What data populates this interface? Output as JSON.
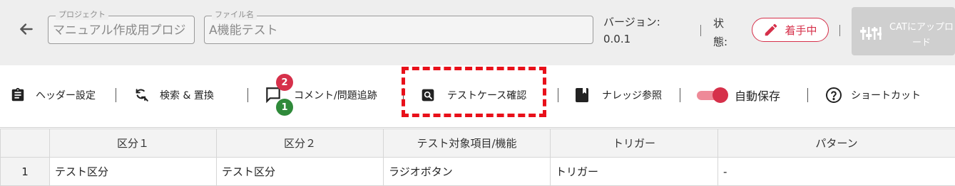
{
  "header": {
    "project_legend": "プロジェクト",
    "project_value": "マニュアル作成用プロジ",
    "file_legend": "ファイル名",
    "file_value": "A機能テスト",
    "version_label": "バージョン:",
    "version_value": "0.0.1",
    "status_label": "状態:",
    "status_value": "着手中",
    "cat_button_label": "CATにアップロード"
  },
  "toolbar": {
    "header_settings": "ヘッダー設定",
    "search_replace": "検索 & 置換",
    "comments": "コメント/問題追跡",
    "comment_badge_red": "2",
    "comment_badge_green": "1",
    "testcase_confirm": "テストケース確認",
    "knowledge": "ナレッジ参照",
    "autosave": "自動保存",
    "autosave_on": true,
    "shortcuts": "ショートカット"
  },
  "table": {
    "headers": [
      "",
      "区分１",
      "区分２",
      "テスト対象項目/機能",
      "トリガー",
      "パターン"
    ],
    "rows": [
      [
        "1",
        "テスト区分",
        "テスト区分",
        "ラジオボタン",
        "トリガー",
        "-"
      ]
    ]
  },
  "colors": {
    "accent": "#d6304a",
    "highlight_dash": "#e8101a",
    "header_bg": "#eeeeee",
    "badge_green": "#2f8a3a"
  },
  "icons": {
    "back": "arrow-left-icon",
    "status": "pencil-icon",
    "cat": "upload-sliders-icon",
    "header_settings": "clipboard-icon",
    "search_replace": "search-replace-icon",
    "comments": "chat-bubble-icon",
    "testcase": "search-box-icon",
    "knowledge": "book-icon",
    "shortcuts": "help-circle-icon"
  }
}
